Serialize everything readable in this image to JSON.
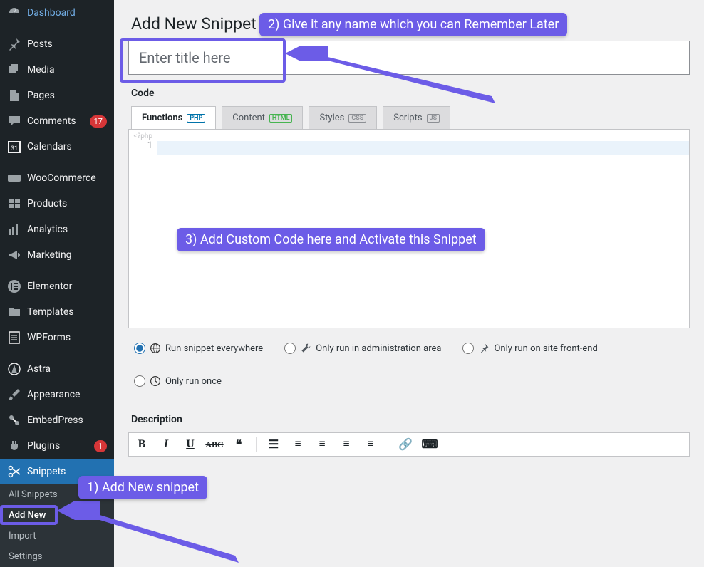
{
  "sidebar": {
    "items": [
      {
        "key": "dashboard",
        "label": "Dashboard"
      },
      {
        "key": "posts",
        "label": "Posts"
      },
      {
        "key": "media",
        "label": "Media"
      },
      {
        "key": "pages",
        "label": "Pages"
      },
      {
        "key": "comments",
        "label": "Comments",
        "badge": "17"
      },
      {
        "key": "calendars",
        "label": "Calendars"
      },
      {
        "key": "woocommerce",
        "label": "WooCommerce"
      },
      {
        "key": "products",
        "label": "Products"
      },
      {
        "key": "analytics",
        "label": "Analytics"
      },
      {
        "key": "marketing",
        "label": "Marketing"
      },
      {
        "key": "elementor",
        "label": "Elementor"
      },
      {
        "key": "templates",
        "label": "Templates"
      },
      {
        "key": "wpforms",
        "label": "WPForms"
      },
      {
        "key": "astra",
        "label": "Astra"
      },
      {
        "key": "appearance",
        "label": "Appearance"
      },
      {
        "key": "embedpress",
        "label": "EmbedPress"
      },
      {
        "key": "plugins",
        "label": "Plugins",
        "badge": "1"
      },
      {
        "key": "snippets",
        "label": "Snippets",
        "current": true
      }
    ],
    "submenu": [
      {
        "label": "All Snippets"
      },
      {
        "label": "Add New",
        "current": true
      },
      {
        "label": "Import"
      },
      {
        "label": "Settings"
      }
    ]
  },
  "page": {
    "title": "Add New Snippet",
    "title_placeholder": "Enter title here",
    "title_value": "",
    "code_label": "Code",
    "description_label": "Description"
  },
  "tabs": [
    {
      "label": "Functions",
      "badge": "PHP",
      "badgeClass": "php-b",
      "active": true
    },
    {
      "label": "Content",
      "badge": "HTML",
      "badgeClass": "html-b"
    },
    {
      "label": "Styles",
      "badge": "CSS",
      "badgeClass": "css-b"
    },
    {
      "label": "Scripts",
      "badge": "JS",
      "badgeClass": "js-b"
    }
  ],
  "editor": {
    "hint": "<?php",
    "line_number": "1"
  },
  "scope": [
    {
      "label": "Run snippet everywhere",
      "checked": true,
      "icon": "globe"
    },
    {
      "label": "Only run in administration area",
      "icon": "wrench"
    },
    {
      "label": "Only run on site front-end",
      "icon": "pin"
    },
    {
      "label": "Only run once",
      "icon": "clock"
    }
  ],
  "annotations": {
    "step1": "1) Add New snippet",
    "step2": "2) Give it any name which you can Remember Later",
    "step3": "3) Add Custom Code here and Activate this Snippet"
  }
}
